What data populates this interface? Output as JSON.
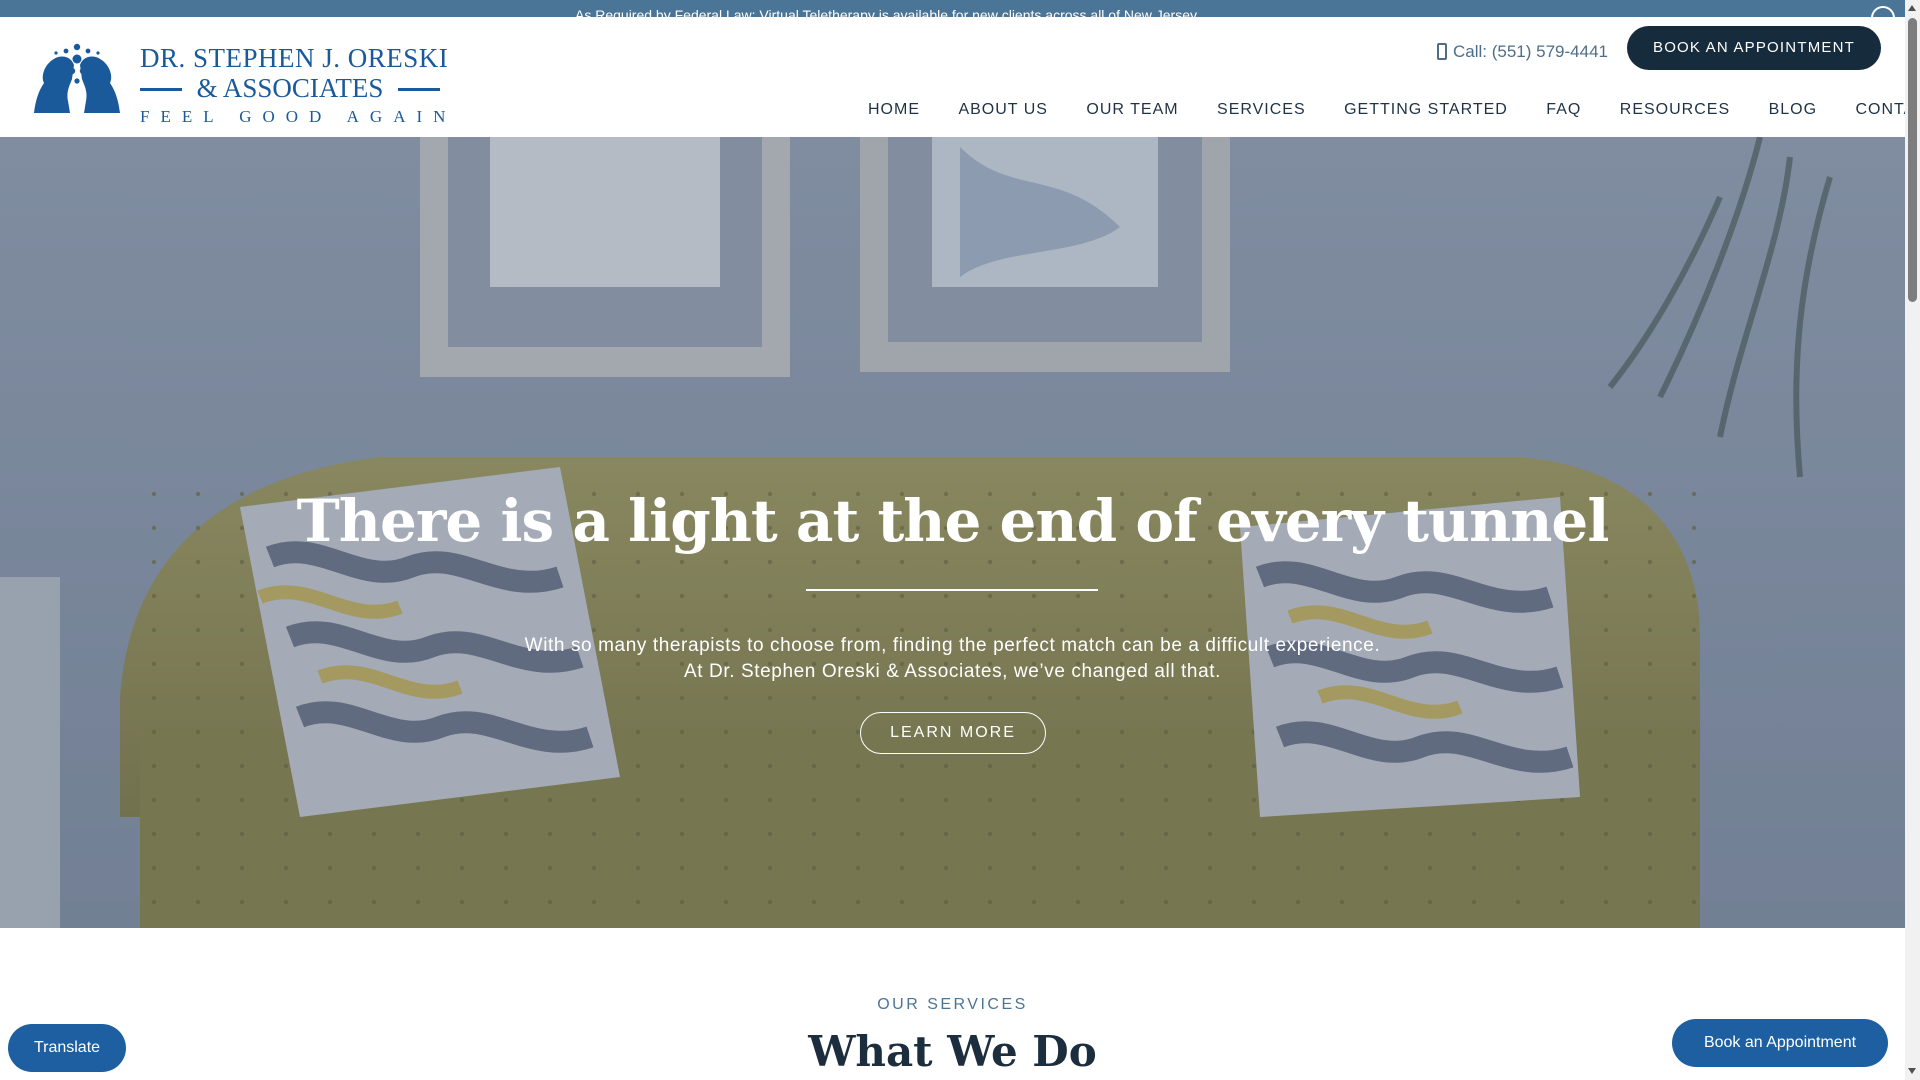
{
  "announcement": {
    "text": "As Required by Federal Law: Virtual Teletherapy is available for new clients across all of New Jersey"
  },
  "logo": {
    "line1": "DR. STEPHEN J. ORESKI",
    "line2": "& ASSOCIATES",
    "line3": "FEEL GOOD AGAIN",
    "icon": "twin-heads-logo-icon",
    "color": "#1a5a9a"
  },
  "header": {
    "call_label": "Call: (551) 579-4441",
    "phone_icon": "mobile-phone-icon",
    "book_label": "BOOK AN APPOINTMENT"
  },
  "nav": {
    "items": [
      "HOME",
      "ABOUT US",
      "OUR TEAM",
      "SERVICES",
      "GETTING STARTED",
      "FAQ",
      "RESOURCES",
      "BLOG",
      "CONTACT"
    ]
  },
  "hero": {
    "title": "There is a light at the end of every tunnel",
    "text_line1": "With so many therapists to choose from, finding the perfect match can be a difficult experience.",
    "text_line2": "At Dr. Stephen Oreski & Associates, we’ve changed all that.",
    "cta_label": "LEARN MORE"
  },
  "services": {
    "eyebrow": "OUR SERVICES",
    "title": "What We Do"
  },
  "floating": {
    "translate_label": "Translate",
    "book_label": "Book an Appointment"
  },
  "colors": {
    "announcement_bar": "#4a7596",
    "dark_button": "#162b3b",
    "blue_button": "#1d5fa0",
    "sofa": "#8f8a4b",
    "wall": "#8e99ab"
  }
}
